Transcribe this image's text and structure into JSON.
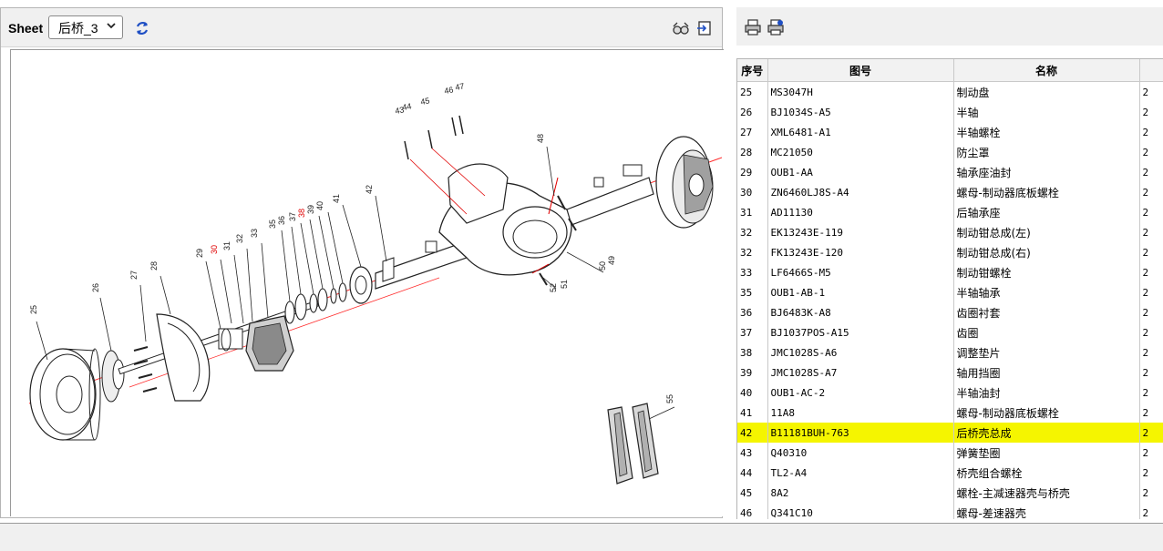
{
  "toolbar": {
    "sheet_label": "Sheet",
    "sheet_value": "后桥_3",
    "refresh_icon": "refresh-icon",
    "left_icons": [
      "glasses-icon",
      "export-icon"
    ],
    "right_icons": [
      "print-icon",
      "print-all-icon"
    ]
  },
  "drawing": {
    "callouts": [
      "25",
      "26",
      "27",
      "28",
      "29",
      "30",
      "31",
      "32",
      "33",
      "35",
      "36",
      "37",
      "38",
      "39",
      "40",
      "41",
      "42",
      "43",
      "44",
      "45",
      "46",
      "47",
      "48",
      "49",
      "50",
      "51",
      "52",
      "55"
    ],
    "highlighted_callouts": [
      "30",
      "38"
    ]
  },
  "parts_table": {
    "headers": [
      "序号",
      "图号",
      "名称",
      ""
    ],
    "rows": [
      {
        "seq": "25",
        "part_no": "MS3047H",
        "name": "制动盘",
        "qty": "2"
      },
      {
        "seq": "26",
        "part_no": "BJ1034S-A5",
        "name": "半轴",
        "qty": "2"
      },
      {
        "seq": "27",
        "part_no": "XML6481-A1",
        "name": "半轴螺栓",
        "qty": "2"
      },
      {
        "seq": "28",
        "part_no": "MC21050",
        "name": "防尘罩",
        "qty": "2"
      },
      {
        "seq": "29",
        "part_no": "OUB1-AA",
        "name": "轴承座油封",
        "qty": "2"
      },
      {
        "seq": "30",
        "part_no": "ZN6460LJ8S-A4",
        "name": "螺母-制动器底板螺栓",
        "qty": "2"
      },
      {
        "seq": "31",
        "part_no": "AD11130",
        "name": "后轴承座",
        "qty": "2"
      },
      {
        "seq": "32",
        "part_no": "EK13243E-119",
        "name": "制动钳总成(左)",
        "qty": "2"
      },
      {
        "seq": "32",
        "part_no": "FK13243E-120",
        "name": "制动钳总成(右)",
        "qty": "2"
      },
      {
        "seq": "33",
        "part_no": "LF6466S-M5",
        "name": "制动钳螺栓",
        "qty": "2"
      },
      {
        "seq": "35",
        "part_no": "OUB1-AB-1",
        "name": "半轴轴承",
        "qty": "2"
      },
      {
        "seq": "36",
        "part_no": "BJ6483K-A8",
        "name": "齿圈衬套",
        "qty": "2"
      },
      {
        "seq": "37",
        "part_no": "BJ1037POS-A15",
        "name": "齿圈",
        "qty": "2"
      },
      {
        "seq": "38",
        "part_no": "JMC1028S-A6",
        "name": "调整垫片",
        "qty": "2"
      },
      {
        "seq": "39",
        "part_no": "JMC1028S-A7",
        "name": "轴用挡圈",
        "qty": "2"
      },
      {
        "seq": "40",
        "part_no": "OUB1-AC-2",
        "name": "半轴油封",
        "qty": "2"
      },
      {
        "seq": "41",
        "part_no": "11A8",
        "name": "螺母-制动器底板螺栓",
        "qty": "2"
      },
      {
        "seq": "42",
        "part_no": "B11181BUH-763",
        "name": "后桥壳总成",
        "qty": "2",
        "selected": true
      },
      {
        "seq": "43",
        "part_no": "Q40310",
        "name": "弹簧垫圈",
        "qty": "2"
      },
      {
        "seq": "44",
        "part_no": "TL2-A4",
        "name": "桥壳组合螺栓",
        "qty": "2"
      },
      {
        "seq": "45",
        "part_no": "8A2",
        "name": "螺栓-主减速器壳与桥壳",
        "qty": "2"
      },
      {
        "seq": "46",
        "part_no": "Q341C10",
        "name": "螺母-差速器壳",
        "qty": "2"
      }
    ]
  },
  "colors": {
    "highlight_row": "#f5f500",
    "callout_red": "#e00000",
    "axis_red": "#ff3030"
  }
}
